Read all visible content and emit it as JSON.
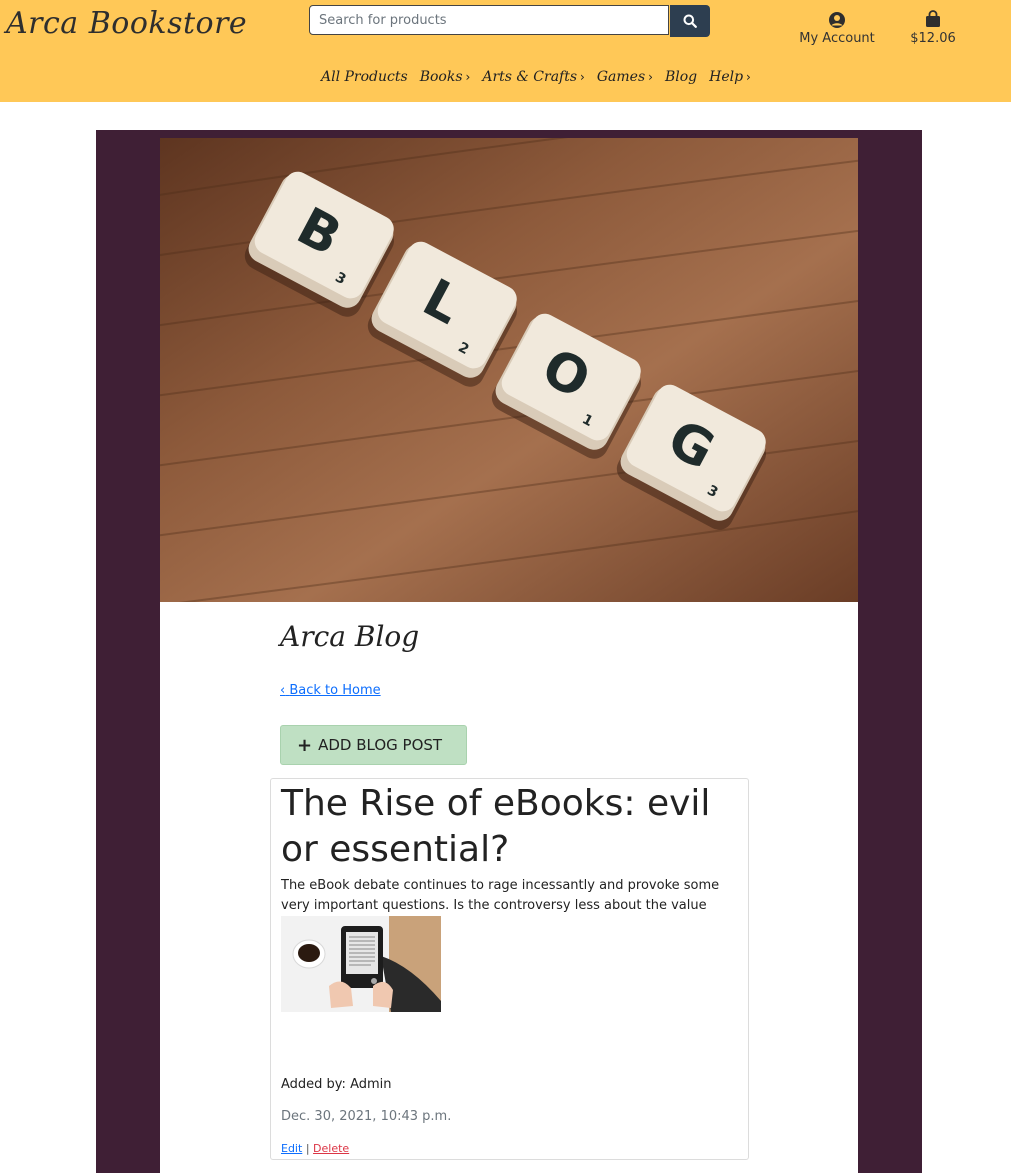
{
  "header": {
    "logo": "Arca Bookstore",
    "search": {
      "placeholder": "Search for products",
      "value": ""
    },
    "account_label": "My Account",
    "bag_total": "$12.06",
    "nav": [
      {
        "label": "All Products",
        "has_chevron": false
      },
      {
        "label": "Books",
        "has_chevron": true
      },
      {
        "label": "Arts & Crafts",
        "has_chevron": true
      },
      {
        "label": "Games",
        "has_chevron": true
      },
      {
        "label": "Blog",
        "has_chevron": false
      },
      {
        "label": "Help",
        "has_chevron": true
      }
    ]
  },
  "hero": {
    "tiles": [
      {
        "letter": "B",
        "score": "3"
      },
      {
        "letter": "L",
        "score": "2"
      },
      {
        "letter": "O",
        "score": "1"
      },
      {
        "letter": "G",
        "score": "3"
      }
    ]
  },
  "blog": {
    "title": "Arca Blog",
    "back_link": "Back to Home",
    "add_button": "ADD BLOG POST",
    "posts": [
      {
        "title": "The Rise of eBooks: evil or essential?",
        "excerpt": "The eBook debate continues to rage incessantly and provoke some very important questions. Is the controversy less about the value of…",
        "author": "Added by: Admin",
        "date": "Dec. 30, 2021, 10:43 p.m.",
        "edit_label": "Edit",
        "separator": "|",
        "delete_label": "Delete"
      }
    ]
  },
  "colors": {
    "header_bg": "#ffc857",
    "frame_bg": "#3f1f35",
    "search_button": "#2d3e50",
    "add_button_bg": "#bfe0c3",
    "link": "#0d6efd",
    "delete": "#dc3545"
  },
  "icons": {
    "search": "search-icon",
    "account": "user-circle-icon",
    "bag": "shopping-bag-icon",
    "chevron": "chevron-right-icon",
    "plus": "plus-icon"
  }
}
